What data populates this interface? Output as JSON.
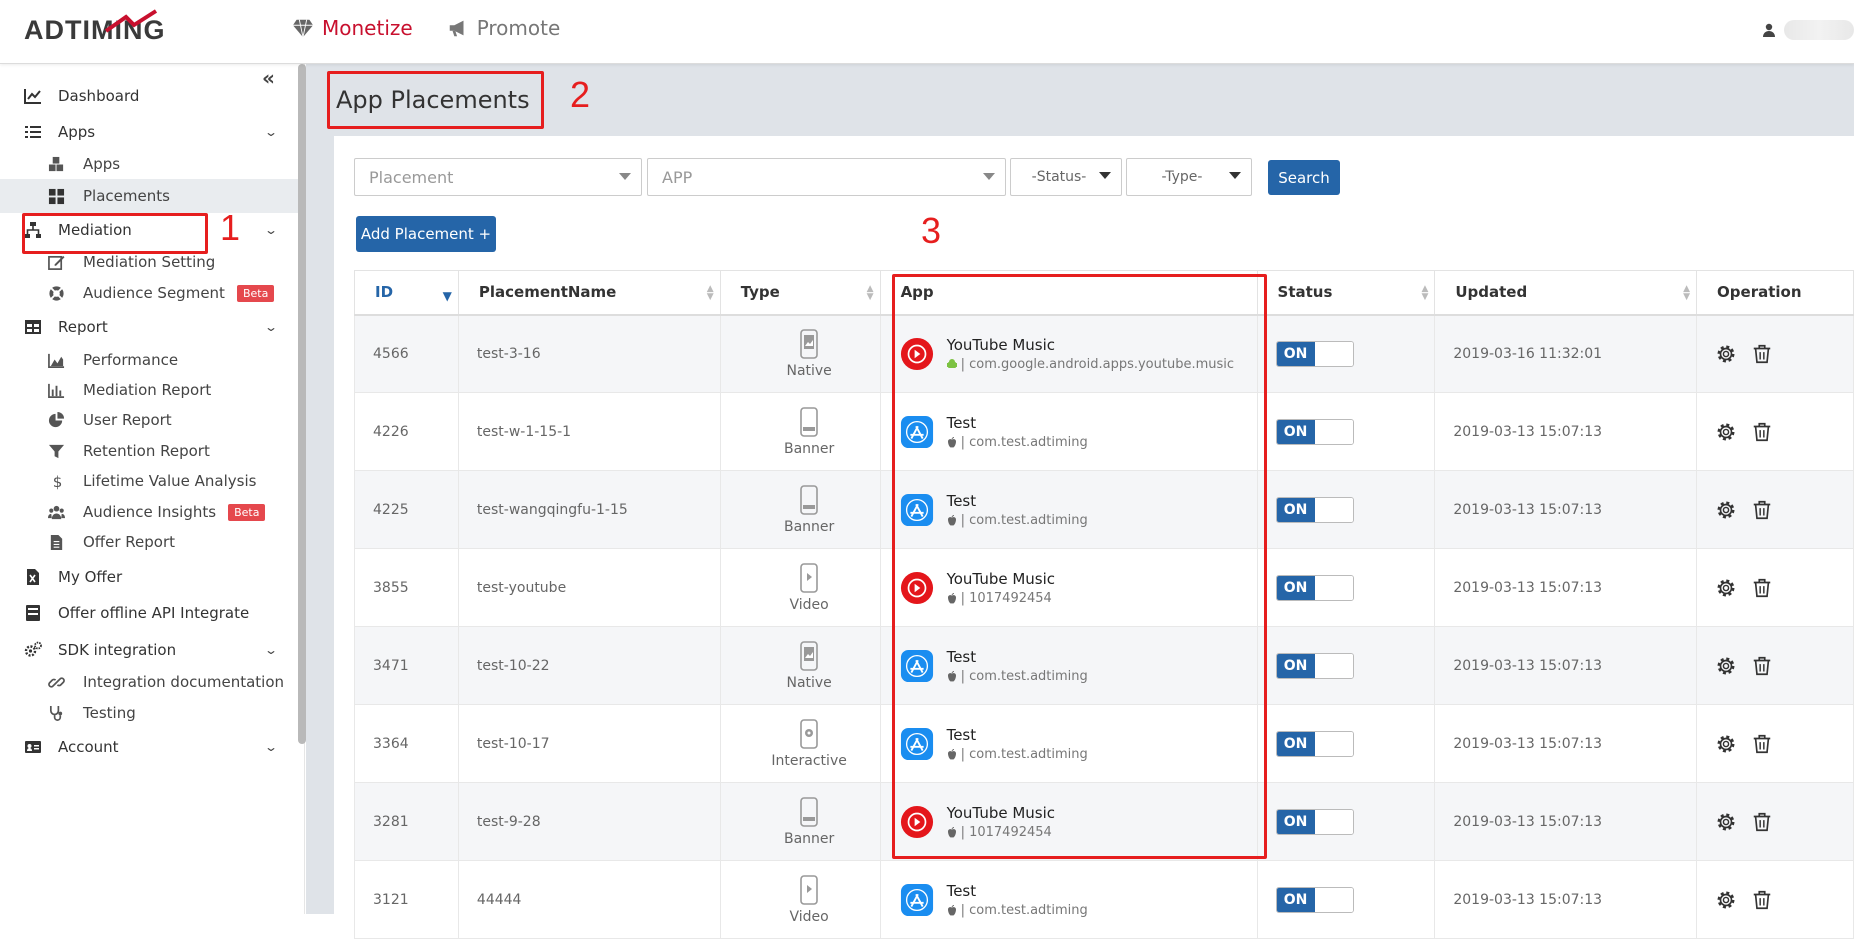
{
  "header": {
    "logo": "ADTIMING",
    "nav": [
      {
        "label": "Monetize",
        "active": true
      },
      {
        "label": "Promote",
        "active": false
      }
    ]
  },
  "sidebar": {
    "items": [
      {
        "label": "Dashboard",
        "icon": "chart-line-icon",
        "level": 1
      },
      {
        "label": "Apps",
        "icon": "list-icon",
        "level": 1,
        "expandable": true
      },
      {
        "label": "Apps",
        "icon": "cubes-icon",
        "level": 2
      },
      {
        "label": "Placements",
        "icon": "grid-icon",
        "level": 2,
        "active": true
      },
      {
        "label": "Mediation",
        "icon": "sitemap-icon",
        "level": 1,
        "expandable": true
      },
      {
        "label": "Mediation Setting",
        "icon": "edit-icon",
        "level": 2
      },
      {
        "label": "Audience Segment",
        "icon": "lifebuoy-icon",
        "level": 2,
        "badge": "Beta"
      },
      {
        "label": "Report",
        "icon": "table-icon",
        "level": 1,
        "expandable": true
      },
      {
        "label": "Performance",
        "icon": "area-chart-icon",
        "level": 2
      },
      {
        "label": "Mediation Report",
        "icon": "bar-chart-icon",
        "level": 2
      },
      {
        "label": "User Report",
        "icon": "pie-chart-icon",
        "level": 2
      },
      {
        "label": "Retention Report",
        "icon": "filter-icon",
        "level": 2
      },
      {
        "label": "Lifetime Value Analysis",
        "icon": "dollar-icon",
        "level": 2
      },
      {
        "label": "Audience Insights",
        "icon": "users-icon",
        "level": 2,
        "badge": "Beta"
      },
      {
        "label": "Offer Report",
        "icon": "file-icon",
        "level": 2
      },
      {
        "label": "My Offer",
        "icon": "excel-icon",
        "level": 1
      },
      {
        "label": "Offer offline API Integrate",
        "icon": "server-icon",
        "level": 1
      },
      {
        "label": "SDK integration",
        "icon": "cogs-icon",
        "level": 1,
        "expandable": true
      },
      {
        "label": "Integration documentation",
        "icon": "link-icon",
        "level": 2
      },
      {
        "label": "Testing",
        "icon": "stethoscope-icon",
        "level": 2
      },
      {
        "label": "Account",
        "icon": "id-card-icon",
        "level": 1,
        "expandable": true
      }
    ]
  },
  "annotations": [
    "1",
    "2",
    "3"
  ],
  "page": {
    "title": "App Placements"
  },
  "filters": {
    "placement": "Placement",
    "app": "APP",
    "status": "-Status-",
    "type": "-Type-",
    "search": "Search"
  },
  "add_button": "Add Placement +",
  "table": {
    "headers": [
      "ID",
      "PlacementName",
      "Type",
      "App",
      "Status",
      "Updated",
      "Operation"
    ],
    "rows": [
      {
        "id": "4566",
        "name": "test-3-16",
        "type": "Native",
        "type_icon": "native",
        "app": "YouTube Music",
        "platform": "android",
        "pkg": "| com.google.android.apps.youtube.music",
        "app_icon": "youtube",
        "status": "ON",
        "updated": "2019-03-16 11:32:01"
      },
      {
        "id": "4226",
        "name": "test-w-1-15-1",
        "type": "Banner",
        "type_icon": "banner",
        "app": "Test",
        "platform": "apple",
        "pkg": "| com.test.adtiming",
        "app_icon": "appstore",
        "status": "ON",
        "updated": "2019-03-13 15:07:13"
      },
      {
        "id": "4225",
        "name": "test-wangqingfu-1-15",
        "type": "Banner",
        "type_icon": "banner",
        "app": "Test",
        "platform": "apple",
        "pkg": "| com.test.adtiming",
        "app_icon": "appstore",
        "status": "ON",
        "updated": "2019-03-13 15:07:13"
      },
      {
        "id": "3855",
        "name": "test-youtube",
        "type": "Video",
        "type_icon": "video",
        "app": "YouTube Music",
        "platform": "apple",
        "pkg": "| 1017492454",
        "app_icon": "youtube",
        "status": "ON",
        "updated": "2019-03-13 15:07:13"
      },
      {
        "id": "3471",
        "name": "test-10-22",
        "type": "Native",
        "type_icon": "native",
        "app": "Test",
        "platform": "apple",
        "pkg": "| com.test.adtiming",
        "app_icon": "appstore",
        "status": "ON",
        "updated": "2019-03-13 15:07:13"
      },
      {
        "id": "3364",
        "name": "test-10-17",
        "type": "Interactive",
        "type_icon": "interactive",
        "app": "Test",
        "platform": "apple",
        "pkg": "| com.test.adtiming",
        "app_icon": "appstore",
        "status": "ON",
        "updated": "2019-03-13 15:07:13"
      },
      {
        "id": "3281",
        "name": "test-9-28",
        "type": "Banner",
        "type_icon": "banner",
        "app": "YouTube Music",
        "platform": "apple",
        "pkg": "| 1017492454",
        "app_icon": "youtube",
        "status": "ON",
        "updated": "2019-03-13 15:07:13"
      },
      {
        "id": "3121",
        "name": "44444",
        "type": "Video",
        "type_icon": "video",
        "app": "Test",
        "platform": "apple",
        "pkg": "| com.test.adtiming",
        "app_icon": "appstore",
        "status": "ON",
        "updated": "2019-03-13 15:07:13"
      }
    ]
  },
  "colors": {
    "accent": "#2565a8",
    "brand": "#c8102e",
    "annotation": "#e61e1e",
    "beta": "#e5484d"
  }
}
